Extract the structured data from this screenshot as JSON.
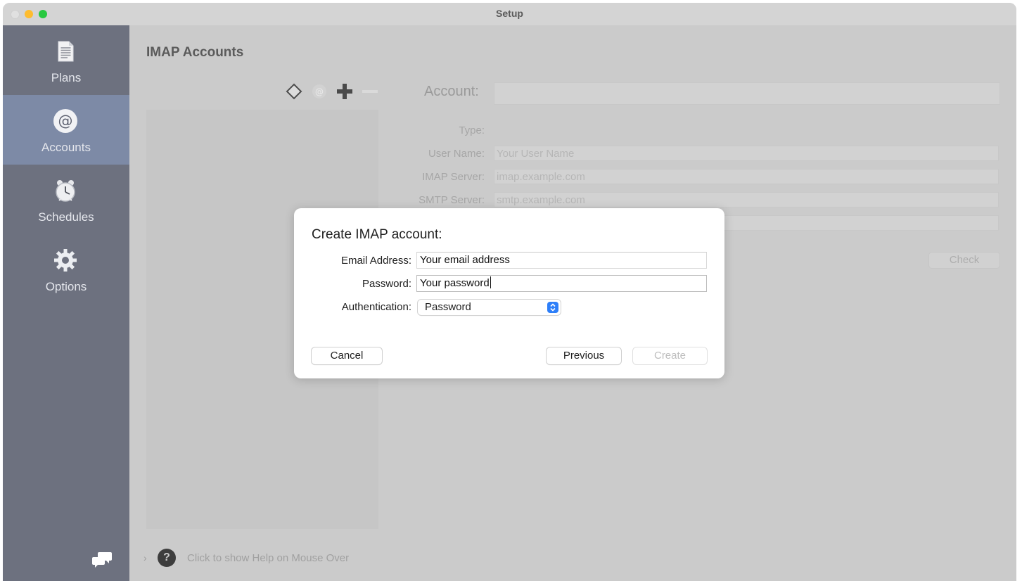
{
  "window": {
    "title": "Setup"
  },
  "sidebar": {
    "items": [
      {
        "label": "Plans",
        "icon": "document-icon"
      },
      {
        "label": "Accounts",
        "icon": "at-sign-icon",
        "selected": true
      },
      {
        "label": "Schedules",
        "icon": "alarm-clock-icon"
      },
      {
        "label": "Options",
        "icon": "gear-icon"
      }
    ],
    "footer_icon": "chat-bubbles-icon"
  },
  "main": {
    "heading": "IMAP Accounts",
    "toolbar_icons": [
      "diamond-icon",
      "at-sign-icon",
      "plus-icon",
      "minus-icon"
    ],
    "account_label": "Account:",
    "account_value": "",
    "form": {
      "type_label": "Type:",
      "username_label": "User Name:",
      "username_placeholder": "Your User Name",
      "imap_label": "IMAP Server:",
      "imap_placeholder": "imap.example.com",
      "smtp_label": "SMTP Server:",
      "smtp_placeholder": "smtp.example.com"
    },
    "check_button": "Check",
    "help_text": "Click to show Help on Mouse Over",
    "help_icon": "?"
  },
  "dialog": {
    "title": "Create IMAP account:",
    "email_label": "Email Address:",
    "email_value": "Your email address",
    "password_label": "Password:",
    "password_value": "Your password",
    "auth_label": "Authentication:",
    "auth_selected": "Password",
    "cancel_button": "Cancel",
    "previous_button": "Previous",
    "create_button": "Create",
    "accent": "#2d7ff9"
  }
}
